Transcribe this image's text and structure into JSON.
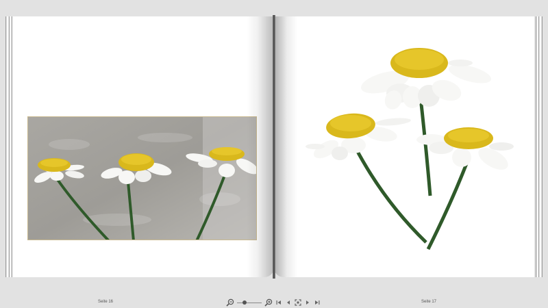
{
  "pages": {
    "left_label": "Seite 16",
    "right_label": "Seite 17"
  },
  "toolbar": {
    "zoom": 0.25,
    "icons": [
      "zoom-out-icon",
      "zoom-in-icon",
      "first-page-icon",
      "previous-page-icon",
      "fullscreen-icon",
      "next-page-icon",
      "last-page-icon"
    ]
  },
  "colors": {
    "background": "#e2e2e2",
    "page": "#ffffff",
    "petal": "#f7f7f5",
    "flower_center": "#d9b81c",
    "stem": "#2f5a2a",
    "photo_frame": "#c9b98f"
  }
}
